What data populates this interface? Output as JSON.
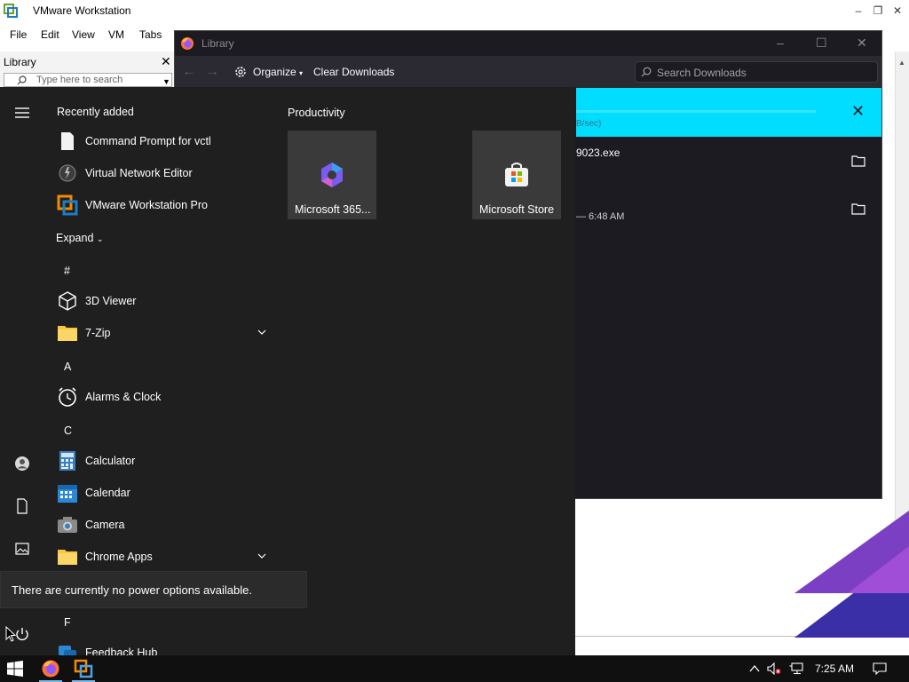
{
  "vmware": {
    "title": "VMware Workstation",
    "menu": [
      "File",
      "Edit",
      "View",
      "VM",
      "Tabs"
    ],
    "library_title": "Library",
    "library_search_placeholder": "Type here to search"
  },
  "firefox_library": {
    "title": "Library",
    "organize": "Organize",
    "clear_downloads": "Clear Downloads",
    "search_placeholder": "Search Downloads",
    "download_speed": "B/sec)",
    "file1_name": "9023.exe",
    "file2_meta": "— 6:48 AM"
  },
  "start_menu": {
    "recently_added_heading": "Recently added",
    "recent_apps": [
      "Command Prompt for vctl",
      "Virtual Network Editor",
      "VMware Workstation Pro"
    ],
    "expand_label": "Expand",
    "sections": {
      "hash": "#",
      "a": "A",
      "c": "C",
      "f": "F"
    },
    "apps": {
      "viewer3d": "3D Viewer",
      "zip7": "7-Zip",
      "alarms": "Alarms & Clock",
      "calculator": "Calculator",
      "calendar": "Calendar",
      "camera": "Camera",
      "chrome_apps": "Chrome Apps",
      "feedback": "Feedback Hub"
    },
    "productivity_heading": "Productivity",
    "tiles": [
      "Microsoft 365...",
      "Microsoft Store"
    ],
    "power_tooltip": "There are currently no power options available."
  },
  "taskbar": {
    "time": "7:25 AM"
  },
  "colors": {
    "start_bg": "#1f1f1f",
    "firefox_accent": "#00ddff",
    "taskbar_bg": "#101010"
  }
}
